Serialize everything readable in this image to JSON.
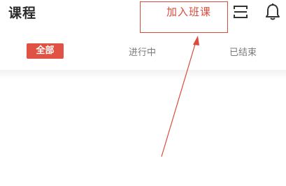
{
  "header": {
    "title": "课程",
    "join_class_label": "加入班课"
  },
  "icons": {
    "scan": "scan-icon",
    "bell": "bell-icon"
  },
  "tabs": [
    {
      "label": "全部",
      "active": true
    },
    {
      "label": "进行中",
      "active": false
    },
    {
      "label": "已结束",
      "active": false
    }
  ],
  "colors": {
    "accent": "#e05243",
    "annotation": "#d94a3c"
  }
}
